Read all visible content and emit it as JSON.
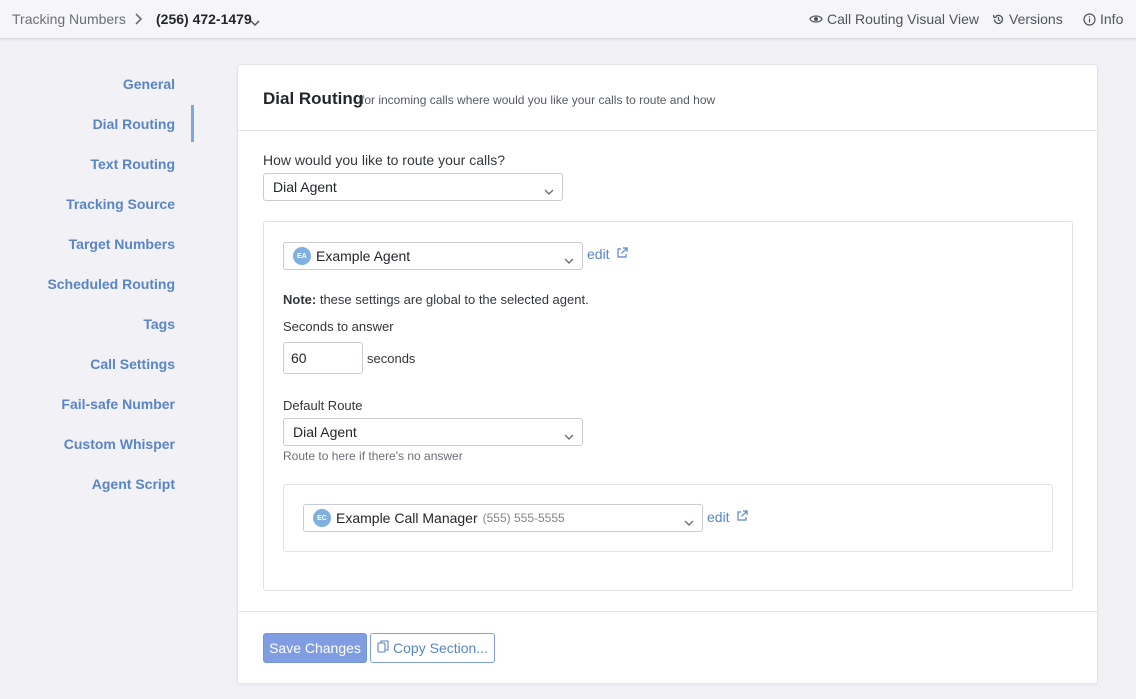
{
  "header": {
    "breadcrumb_root": "Tracking Numbers",
    "breadcrumb_current": "(256) 472-1479",
    "links": [
      {
        "label": "Call Routing Visual View",
        "icon": "eye-icon"
      },
      {
        "label": "Versions",
        "icon": "history-icon"
      },
      {
        "label": "Info",
        "icon": "info-icon"
      }
    ]
  },
  "sidebar": {
    "active": "Dial Routing",
    "items": [
      {
        "label": "General"
      },
      {
        "label": "Dial Routing"
      },
      {
        "label": "Text Routing"
      },
      {
        "label": "Tracking Source"
      },
      {
        "label": "Target Numbers"
      },
      {
        "label": "Scheduled Routing"
      },
      {
        "label": "Tags"
      },
      {
        "label": "Call Settings"
      },
      {
        "label": "Fail-safe Number"
      },
      {
        "label": "Custom Whisper"
      },
      {
        "label": "Agent Script"
      }
    ]
  },
  "section": {
    "title": "Dial Routing",
    "subtitle": "for incoming calls where would you like your calls to route and how",
    "route_question": "How would you like to route your calls?",
    "route_value": "Dial Agent",
    "agent": {
      "initials": "EA",
      "name": "Example Agent",
      "edit_label": "edit"
    },
    "note_bold": "Note:",
    "note_text": " these settings are global to the selected agent.",
    "seconds_label": "Seconds to answer",
    "seconds_value": "60",
    "seconds_unit": "seconds",
    "default_route_label": "Default Route",
    "default_route_value": "Dial Agent",
    "default_route_help": "Route to here if there's no answer",
    "call_manager": {
      "initials": "EC",
      "name": "Example Call Manager",
      "phone": "(555) 555-5555",
      "edit_label": "edit"
    }
  },
  "actions": {
    "save_label": "Save Changes",
    "copy_label": "Copy Section..."
  },
  "colors": {
    "accent": "#5a85c4",
    "primary_button": "#7f9de0",
    "background": "#f1f1f6"
  }
}
